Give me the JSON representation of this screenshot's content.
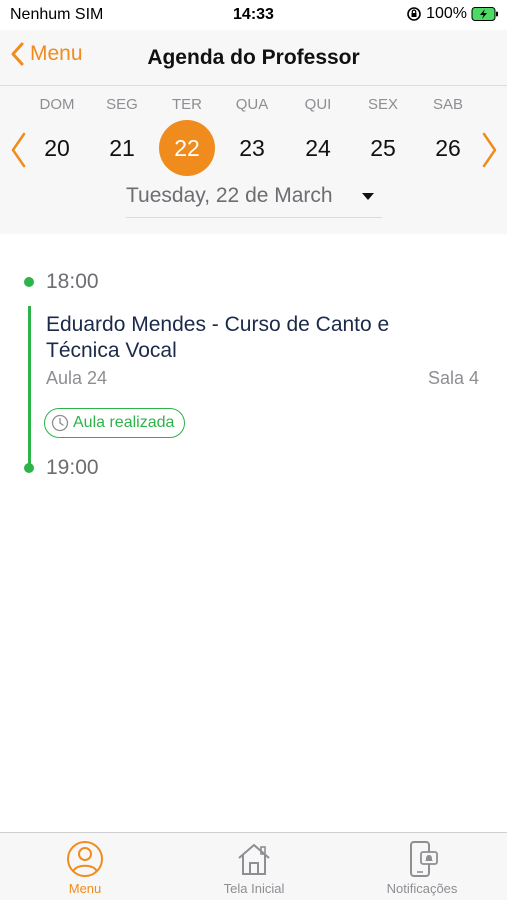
{
  "status": {
    "carrier": "Nenhum SIM",
    "time": "14:33",
    "battery": "100%"
  },
  "nav": {
    "back_label": "Menu",
    "title": "Agenda do Professor"
  },
  "week": {
    "day_names": [
      "DOM",
      "SEG",
      "TER",
      "QUA",
      "QUI",
      "SEX",
      "SAB"
    ],
    "day_numbers": [
      "20",
      "21",
      "22",
      "23",
      "24",
      "25",
      "26"
    ],
    "selected_index": 2,
    "selected_date_label": "Tuesday, 22 de March"
  },
  "schedule": {
    "start_time": "18:00",
    "end_time": "19:00",
    "event_title": "Eduardo Mendes - Curso de Canto e Técnica Vocal",
    "lesson": "Aula 24",
    "room": "Sala 4",
    "status_badge": "Aula realizada"
  },
  "tabs": [
    {
      "label": "Menu",
      "icon": "user-circle-icon",
      "active": true
    },
    {
      "label": "Tela Inicial",
      "icon": "home-icon",
      "active": false
    },
    {
      "label": "Notificações",
      "icon": "phone-notification-icon",
      "active": false
    }
  ],
  "colors": {
    "accent": "#f08c1e",
    "success": "#2db34a"
  }
}
